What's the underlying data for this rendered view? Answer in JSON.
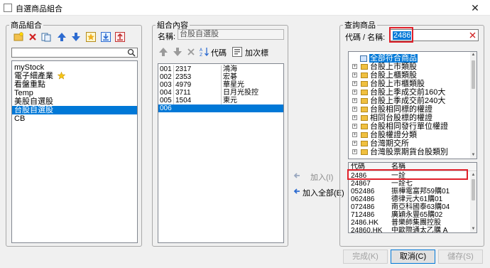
{
  "window": {
    "title": "自選商品組合",
    "close_glyph": "✕"
  },
  "left_panel": {
    "legend": "商品組合",
    "search_placeholder": "",
    "items": [
      {
        "label": "myStock",
        "selected": false
      },
      {
        "label": "電子細產業",
        "selected": false,
        "has_star": true
      },
      {
        "label": "看盤重點",
        "selected": false
      },
      {
        "label": "Temp",
        "selected": false
      },
      {
        "label": "美股自選股",
        "selected": false
      },
      {
        "label": "台股自選股",
        "selected": true
      },
      {
        "label": "CB",
        "selected": false
      }
    ]
  },
  "middle_panel": {
    "legend": "組合內容",
    "name_label": "名稱:",
    "name_value": "台股自選股",
    "toolbar": {
      "code_label": "代碼",
      "add_label": "加次標"
    },
    "rows": [
      {
        "idx": "001",
        "code": "2317",
        "name": "鴻海"
      },
      {
        "idx": "002",
        "code": "2353",
        "name": "宏碁"
      },
      {
        "idx": "003",
        "code": "4979",
        "name": "華星光"
      },
      {
        "idx": "004",
        "code": "3711",
        "name": "日月光投控"
      },
      {
        "idx": "005",
        "code": "1504",
        "name": "東元"
      },
      {
        "idx": "006",
        "code": "",
        "name": ""
      }
    ]
  },
  "actions": {
    "add_label": "加入(I)",
    "add_all_label": "加入全部(E)"
  },
  "right_panel": {
    "legend": "查詢商品",
    "query_label": "代碼 / 名稱:",
    "query_value": "2486",
    "tree": [
      {
        "label": "全部符合商品",
        "selected": true,
        "top_level": true
      },
      {
        "label": "台股上市類股"
      },
      {
        "label": "台股上櫃類股"
      },
      {
        "label": "台股上市櫃類股"
      },
      {
        "label": "台股上季成交前160大"
      },
      {
        "label": "台股上季成交前240大"
      },
      {
        "label": "台股相同標的權證"
      },
      {
        "label": "相同台股標的權證"
      },
      {
        "label": "台股相同發行單位權證"
      },
      {
        "label": "台股權證分類"
      },
      {
        "label": "台灣期交所"
      },
      {
        "label": "台灣股票期貨台股類別"
      }
    ],
    "results_header": {
      "code": "代碼",
      "name": "名稱"
    },
    "results": [
      {
        "code": "2486",
        "name": "一詮"
      },
      {
        "code": "24867",
        "name": "一詮七"
      },
      {
        "code": "052486",
        "name": "振樺電富邦59購01"
      },
      {
        "code": "062486",
        "name": "德律元大61購01"
      },
      {
        "code": "072486",
        "name": "南亞科國泰63購04"
      },
      {
        "code": "712486",
        "name": "廣穎永豐65購02"
      },
      {
        "code": "2486.HK",
        "name": "普樂師集團控股"
      },
      {
        "code": "24860.HK",
        "name": "中歐際通太乙購 A"
      }
    ]
  },
  "footer": {
    "finish_label": "完成(K)",
    "cancel_label": "取消(C)",
    "save_label": "儲存(S)"
  },
  "colors": {
    "selection": "#0078d7",
    "highlight_box": "#e0202a"
  }
}
